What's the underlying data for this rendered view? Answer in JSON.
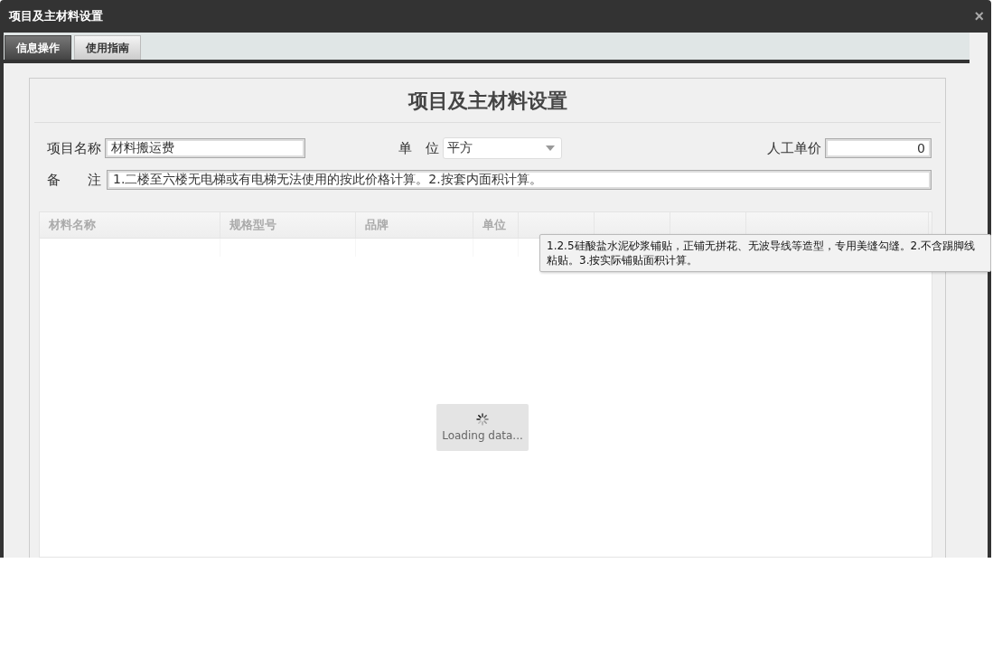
{
  "window": {
    "title": "项目及主材料设置",
    "close": "×"
  },
  "tabs": [
    {
      "label": "信息操作",
      "selected": true
    },
    {
      "label": "使用指南",
      "selected": false
    }
  ],
  "form": {
    "heading": "项目及主材料设置",
    "name": {
      "label": "项目名称",
      "value": "材料搬运费"
    },
    "unit": {
      "label": "单　位",
      "value": "平方"
    },
    "labor_price": {
      "label": "人工单价",
      "value": "0"
    },
    "remark": {
      "label": "备　　注",
      "value": "1.二楼至六楼无电梯或有电梯无法使用的按此价格计算。2.按套内面积计算。"
    }
  },
  "table": {
    "columns": [
      {
        "label": "材料名称"
      },
      {
        "label": "规格型号"
      },
      {
        "label": "品牌"
      },
      {
        "label": "单位"
      },
      {},
      {},
      {},
      {}
    ]
  },
  "loading": {
    "text": "Loading data..."
  },
  "tooltip": {
    "text": "1.2.5硅酸盐水泥砂浆铺贴，正铺无拼花、无波导线等造型，专用美缝勾缝。2.不含踢脚线粘贴。3.按实际铺贴面积计算。"
  }
}
